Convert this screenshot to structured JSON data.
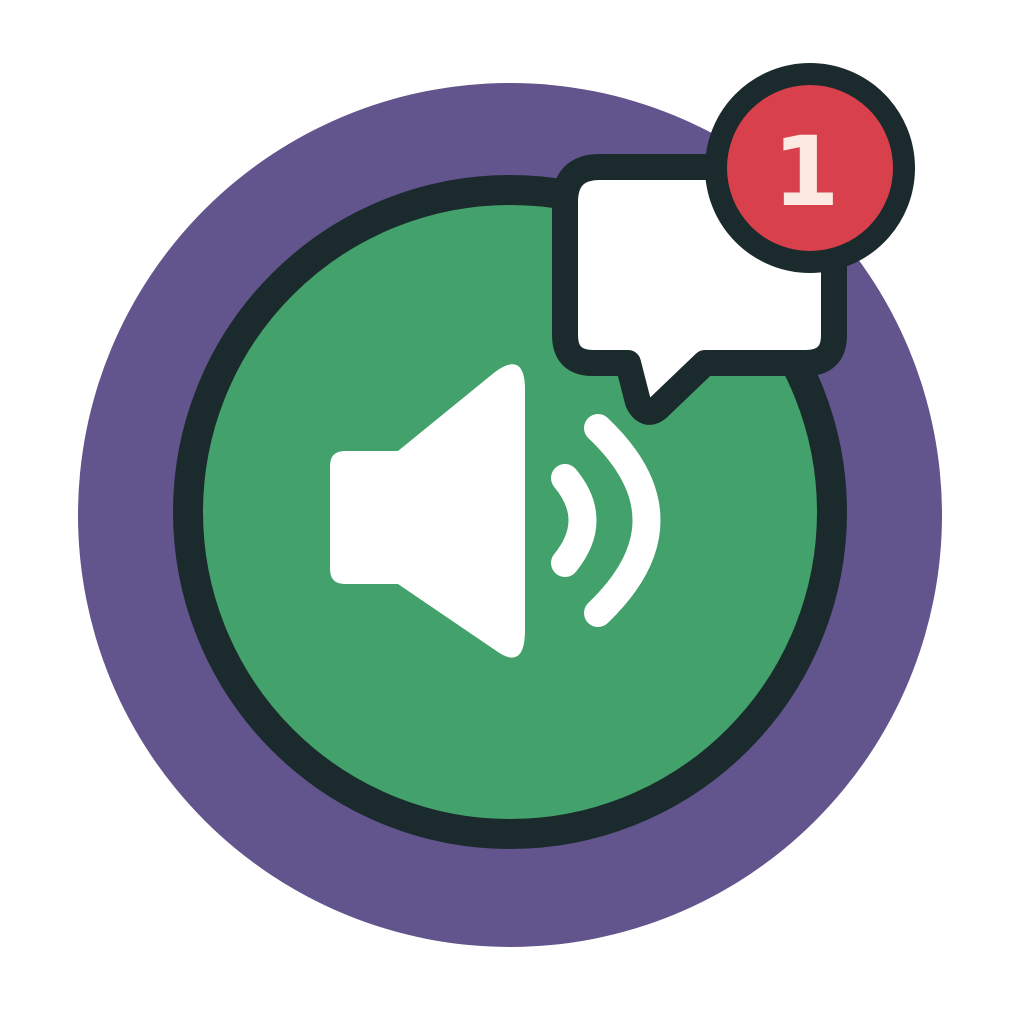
{
  "icons": {
    "main": "speaker-volume-icon",
    "message": "chat-bubble-icon",
    "notification": "notification-badge-icon"
  },
  "badge": {
    "count": "1"
  },
  "colors": {
    "outer_ring": "#62548C",
    "main_fill": "#43A16B",
    "outline": "#1B2A2C",
    "glyph": "#FFFFFF",
    "badge_fill": "#D8414C",
    "badge_text": "#FBE9E2",
    "page_background": "#FFFFFF"
  }
}
